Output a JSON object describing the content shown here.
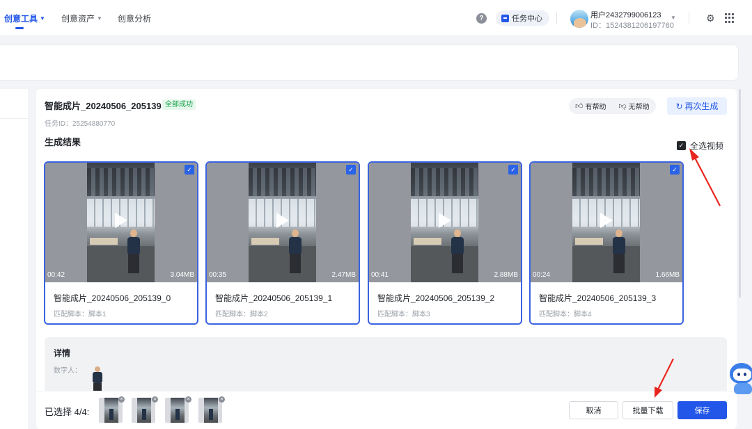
{
  "topnav": {
    "items": [
      {
        "label": "创意工具",
        "active": true
      },
      {
        "label": "创意资产",
        "active": false
      },
      {
        "label": "创意分析",
        "active": false
      }
    ],
    "help_icon": "question-circle-icon",
    "task_center_label": "任务中心",
    "user": {
      "name": "用户2432799006123",
      "id": "ID：1524381206197760"
    },
    "icons": [
      "settings-icon",
      "apps-grid-icon"
    ],
    "accent_color": "#2156e8"
  },
  "task": {
    "title": "智能成片_20240506_205139",
    "status": "全部成功",
    "task_id": "任务ID：25254880770",
    "feedback": {
      "helpful": "有帮助",
      "not_helpful": "无帮助"
    },
    "regenerate_label": "再次生成"
  },
  "results": {
    "section_title": "生成结果",
    "select_all_label": "全选视频",
    "select_all_checked": true,
    "videos": [
      {
        "name": "智能成片_20240506_205139_0",
        "script": "匹配脚本：脚本1",
        "duration": "00:42",
        "size": "3.04MB",
        "checked": true
      },
      {
        "name": "智能成片_20240506_205139_1",
        "script": "匹配脚本：脚本2",
        "duration": "00:35",
        "size": "2.47MB",
        "checked": true
      },
      {
        "name": "智能成片_20240506_205139_2",
        "script": "匹配脚本：脚本3",
        "duration": "00:41",
        "size": "2.88MB",
        "checked": true
      },
      {
        "name": "智能成片_20240506_205139_3",
        "script": "匹配脚本：脚本4",
        "duration": "00:24",
        "size": "1.66MB",
        "checked": true
      }
    ]
  },
  "details": {
    "title": "详情",
    "digital_human_label": "数字人："
  },
  "footer": {
    "selected_label": "已选择 4/4:",
    "cancel_label": "取消",
    "batch_download_label": "批量下载",
    "save_label": "保存"
  }
}
